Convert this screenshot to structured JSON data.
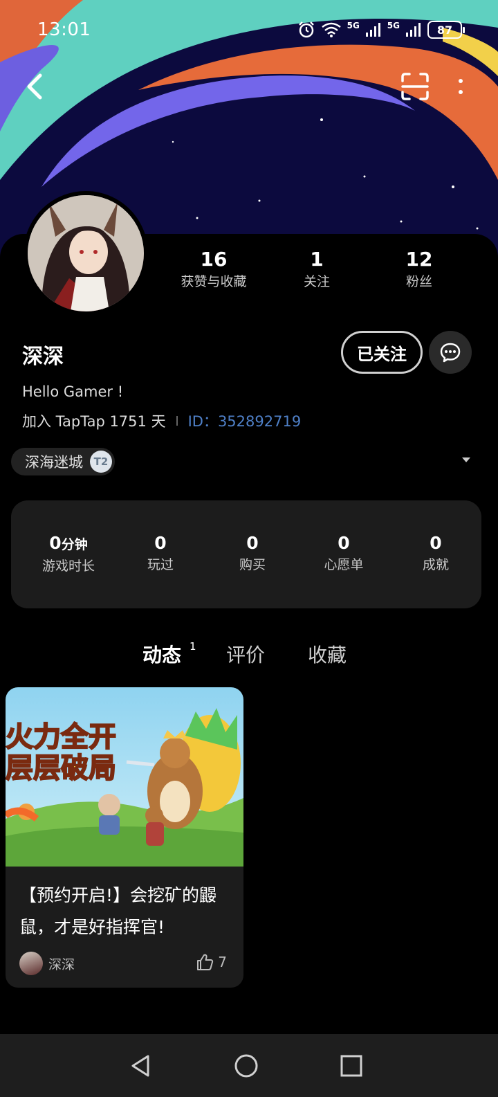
{
  "status_bar": {
    "time": "13:01",
    "battery": "87",
    "network_1": "5G",
    "network_2": "5G"
  },
  "profile": {
    "username": "深深",
    "bio": "Hello Gamer !",
    "join_text": "加入 TapTap 1751 天",
    "uid_text": "ID：352892719",
    "follow_label": "已关注"
  },
  "stats": [
    {
      "value": "16",
      "label": "获赞与收藏"
    },
    {
      "value": "1",
      "label": "关注"
    },
    {
      "value": "12",
      "label": "粉丝"
    }
  ],
  "game_tag": {
    "name": "深海迷城",
    "badge": "T2"
  },
  "play_stats": [
    {
      "value": "0",
      "unit": "分钟",
      "label": "游戏时长"
    },
    {
      "value": "0",
      "label": "玩过"
    },
    {
      "value": "0",
      "label": "购买"
    },
    {
      "value": "0",
      "label": "心愿单"
    },
    {
      "value": "0",
      "label": "成就"
    }
  ],
  "tabs": [
    {
      "label": "动态",
      "count": "1",
      "active": true
    },
    {
      "label": "评价",
      "active": false
    },
    {
      "label": "收藏",
      "active": false
    }
  ],
  "posts": [
    {
      "title": "【预约开启!】会挖矿的鼹鼠，才是好指挥官!",
      "author": "深深",
      "likes": "7",
      "image_text_line1": "火力全开",
      "image_text_line2": "层层破局"
    }
  ],
  "colors": {
    "accent": "#19c4b6",
    "uid": "#4f80c8",
    "card": "#1c1c1c",
    "banner_bg": "#0c0a3e"
  },
  "icons": [
    "back-arrow-icon",
    "scan-icon",
    "more-icon",
    "message-icon",
    "thumbs-up-icon",
    "nav-back-icon",
    "nav-home-icon",
    "nav-recent-icon"
  ]
}
